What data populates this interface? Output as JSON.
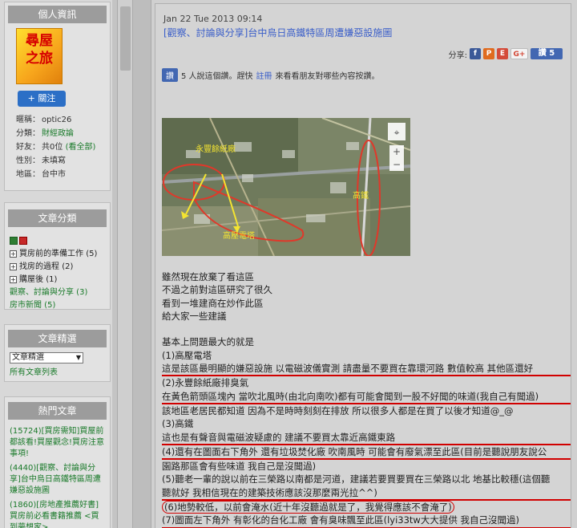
{
  "sidebar": {
    "profile": {
      "title": "個人資訊",
      "logo_lines": [
        "尋屋",
        "之旅"
      ],
      "follow_label": "+ 關注",
      "rows": [
        {
          "label": "暱稱：",
          "value": "optic26"
        },
        {
          "label": "分類：",
          "value": "財經政論"
        },
        {
          "label": "好友：",
          "value": "共0位",
          "link": "(看全部)"
        },
        {
          "label": "性別：",
          "value": "未填寫"
        },
        {
          "label": "地區：",
          "value": "台中市"
        }
      ]
    },
    "categories": {
      "title": "文章分類",
      "items": [
        {
          "label": "買房前的準備工作",
          "count": "(5)"
        },
        {
          "label": "找房的過程",
          "count": "(2)"
        },
        {
          "label": "購屋後",
          "count": "(1)"
        }
      ],
      "links": [
        "觀察、討論與分享 (3)",
        "房市新聞 (5)"
      ]
    },
    "picks": {
      "title": "文章精選",
      "select_value": "文章精選",
      "all_link": "所有文章列表"
    },
    "hot": {
      "title": "熱門文章",
      "items": [
        "(15724)[買房需知]買屋前都該看!買屋觀念!買房注意事項!",
        "(4440)[觀察、討論與分享]台中烏日高鐵特區周遭嫌惡設施圖",
        "(1860)[房地產推薦好書]買房前必看書籍推薦 <買到夢想家>"
      ]
    }
  },
  "post": {
    "date": "Jan 22 Tue 2013 09:14",
    "title": "[觀察、討論與分享]台中烏日高鐵特區周遭嫌惡設施圖",
    "share_label": "分享:",
    "share_like": "讚 5",
    "like_button": "讚",
    "like_text_1": "5 人說這個讚。趕快",
    "like_register": "註冊",
    "like_text_2": "來看看朋友對哪些內容按讚。",
    "map_labels": {
      "paper_mill": "永豐餘紙廠",
      "tower": "高壓電塔",
      "hsr": "高鐵"
    },
    "paragraphs": [
      "雖然現在放棄了看這區",
      "不過之前對這區研究了很久",
      "看到一堆建商在炒作此區",
      "給大家一些建議",
      "",
      "基本上問題最大的就是",
      "(1)高壓電塔",
      "這是該區最明顯的嫌惡設施 以電磁波儀實測 請盡量不要買在靠環河路 數值較高 其他區還好",
      "(2)永豐餘紙廠排臭氣",
      "在黃色箭頭區塊內 當吹北風時(由北向南吹)都有可能會聞到一股不好聞的味道(我自己有聞過)",
      "該地區老居民都知道 因為不是時時刻刻在排放 所以很多人都是在買了以後才知道@_@",
      "(3)高鐵",
      "這也是有聲音與電磁波疑慮的 建議不要買太靠近高鐵東路",
      "(4)還有在圖面右下角外 還有垃圾焚化廠 吹南風時 可能會有廢氣漂至此區(目前是聽說朋友說公",
      "園路那區會有些味道 我自己是沒聞過)",
      "(5)聽老一輩的說以前在三榮路以南都是河道，建議若要買要買在三榮路以北 地基比較穩(這個聽",
      "聽就好 我相信現在的建築技術應該沒那麼兩光拉^^)",
      "(6)地勢較低，以前會淹水(近十年沒聽過就是了，我覺得應該不會淹了)",
      "(7)圖面左下角外 有彰化的台化工廠 會有臭味飄至此區(lyi33tw大大提供 我自己沒聞過)"
    ]
  }
}
